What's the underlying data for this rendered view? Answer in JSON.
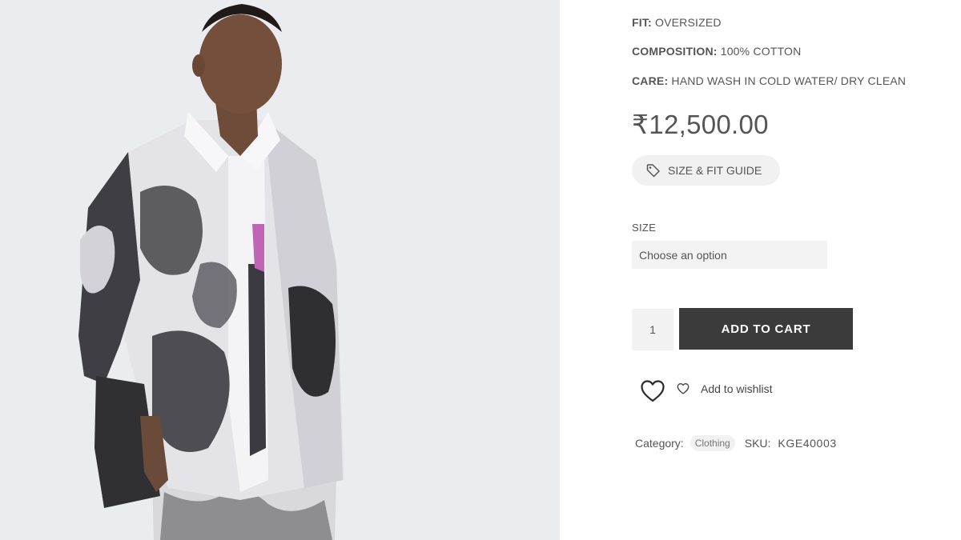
{
  "product": {
    "image_alt": "Model wearing oversized tie-dye shirt",
    "specs": [
      {
        "key": "FIT:",
        "value": " OVERSIZED"
      },
      {
        "key": "COMPOSITION:",
        "value": " 100% COTTON"
      },
      {
        "key": "CARE:",
        "value": " HAND WASH IN COLD WATER/ DRY CLEAN"
      }
    ],
    "price": "₹12,500.00"
  },
  "guide": {
    "label": "SIZE & FIT GUIDE",
    "icon": "tag-icon"
  },
  "size": {
    "label": "SIZE",
    "selected": "Choose an option"
  },
  "cart": {
    "quantity": "1",
    "add_label": "ADD TO CART"
  },
  "wishlist": {
    "label": "Add to wishlist",
    "icon": "heart-icon"
  },
  "meta": {
    "category_label": "Category:",
    "category_value": "Clothing",
    "sku_label": "SKU:",
    "sku_value": "KGE40003"
  },
  "colors": {
    "button_dark": "#3b3b3b",
    "text": "#555555",
    "light_bg": "#f1f1f1"
  }
}
